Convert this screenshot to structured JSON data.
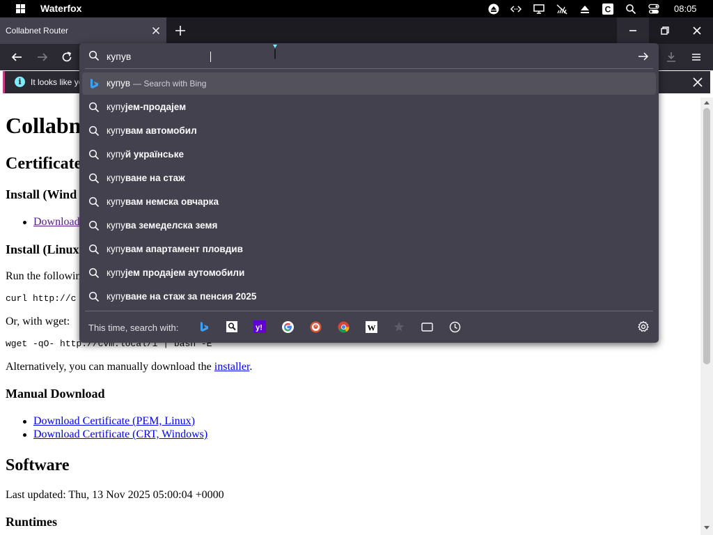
{
  "os": {
    "app_name": "Waterfox",
    "clock": "08:05",
    "tray_icons": [
      "eject-icon",
      "code-arrows-icon",
      "monitor-icon",
      "network-off-icon",
      "upload-icon",
      "c-app-icon",
      "search-icon",
      "toggle-icon"
    ]
  },
  "tab": {
    "title": "Collabnet Router"
  },
  "notification": {
    "text": "It looks like yo"
  },
  "urlbar": {
    "value": "купув",
    "suggestions": [
      {
        "prefix": "купув",
        "bold": "",
        "hint": "— Search with Bing",
        "icon": "bing-icon",
        "selected": true
      },
      {
        "prefix": "купу",
        "bold": "јем-продајем",
        "hint": "",
        "icon": "search-icon"
      },
      {
        "prefix": "купу",
        "bold": "вам автомобил",
        "hint": "",
        "icon": "search-icon"
      },
      {
        "prefix": "купу",
        "bold": "й українське",
        "hint": "",
        "icon": "search-icon"
      },
      {
        "prefix": "купу",
        "bold": "ване на стаж",
        "hint": "",
        "icon": "search-icon"
      },
      {
        "prefix": "купу",
        "bold": "вам немска овчарка",
        "hint": "",
        "icon": "search-icon"
      },
      {
        "prefix": "купу",
        "bold": "ва земеделска земя",
        "hint": "",
        "icon": "search-icon"
      },
      {
        "prefix": "купу",
        "bold": "вам апартамент пловдив",
        "hint": "",
        "icon": "search-icon"
      },
      {
        "prefix": "купу",
        "bold": "јем продајем аутомобили",
        "hint": "",
        "icon": "search-icon"
      },
      {
        "prefix": "купу",
        "bold": "ване на стаж за пенсия 2025",
        "hint": "",
        "icon": "search-icon"
      }
    ],
    "search_with_label": "This time, search with:",
    "engines": [
      "bing-icon",
      "search-page-icon",
      "yahoo-icon",
      "google-icon",
      "duckduckgo-icon",
      "chrome-store-icon",
      "wikipedia-icon",
      "bookmarks-star-icon",
      "tabs-icon",
      "history-icon"
    ]
  },
  "page": {
    "h1": "Collabn",
    "certificate_heading": "Certificate",
    "install_windows_heading": "Install (Wind",
    "download_link_partial": "Download",
    "install_linux_heading": "Install (Linux",
    "run_following": "Run the followin",
    "curl_cmd": "curl http://c",
    "or_wget": "Or, with wget:",
    "wget_cmd": "wget -qO- http://cvm.local/i | bash -E",
    "alt_text_before": "Alternatively, you can manually download the ",
    "alt_link": "installer",
    "alt_text_after": ".",
    "manual_download_heading": "Manual Download",
    "download_pem": "Download Certificate (PEM, Linux)",
    "download_crt": "Download Certificate (CRT, Windows)",
    "software_heading": "Software",
    "last_updated": "Last updated: Thu, 13 Nov 2025 05:00:04 +0000",
    "runtimes_heading": "Runtimes"
  },
  "colors": {
    "os_bar": "#000000",
    "tab_strip": "#1c1b22",
    "toolbar": "#2b2a33",
    "panel": "#42414d",
    "selected_row": "#53525c",
    "link": "#0000ee",
    "visited_link": "#551a8b",
    "notification_accent": "#c63c88"
  }
}
